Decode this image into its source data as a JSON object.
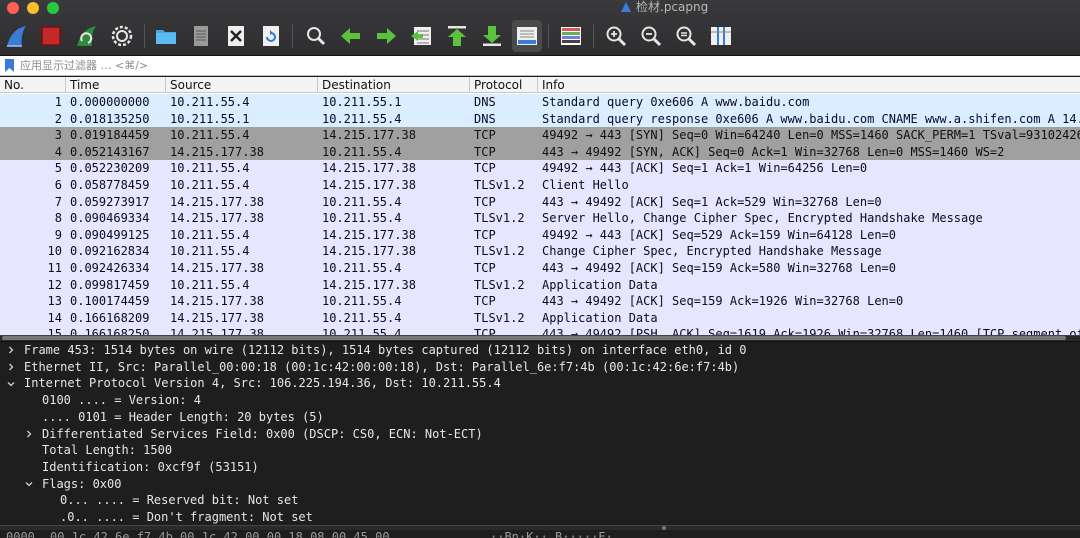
{
  "window": {
    "title": "检材.pcapng"
  },
  "toolbar": {
    "buttons": [
      {
        "name": "start-capture-button",
        "icon": "shark-fin-icon"
      },
      {
        "name": "stop-capture-button",
        "icon": "stop-square-icon"
      },
      {
        "name": "restart-capture-button",
        "icon": "restart-fin-icon"
      },
      {
        "name": "capture-options-button",
        "icon": "gear-icon"
      },
      {
        "name": "open-file-button",
        "icon": "folder-icon"
      },
      {
        "name": "save-file-button",
        "icon": "file-icon"
      },
      {
        "name": "close-file-button",
        "icon": "close-file-icon"
      },
      {
        "name": "reload-file-button",
        "icon": "reload-icon"
      },
      {
        "name": "find-packet-button",
        "icon": "search-icon"
      },
      {
        "name": "go-back-button",
        "icon": "arrow-left-icon"
      },
      {
        "name": "go-forward-button",
        "icon": "arrow-right-icon"
      },
      {
        "name": "go-to-packet-button",
        "icon": "go-to-packet-icon"
      },
      {
        "name": "go-first-packet-button",
        "icon": "arrow-up-bar-icon"
      },
      {
        "name": "go-last-packet-button",
        "icon": "arrow-down-bar-icon"
      },
      {
        "name": "auto-scroll-button",
        "icon": "auto-scroll-icon"
      },
      {
        "name": "colorize-button",
        "icon": "colorize-lines-icon"
      },
      {
        "name": "zoom-in-button",
        "icon": "zoom-in-icon"
      },
      {
        "name": "zoom-out-button",
        "icon": "zoom-out-icon"
      },
      {
        "name": "normal-size-button",
        "icon": "zoom-reset-icon"
      },
      {
        "name": "resize-columns-button",
        "icon": "resize-columns-icon"
      }
    ]
  },
  "filter": {
    "placeholder": "应用显示过滤器 … <⌘/>",
    "value": ""
  },
  "packet_list": {
    "columns": [
      "No.",
      "Time",
      "Source",
      "Destination",
      "Protocol",
      "Info"
    ],
    "rows": [
      {
        "no": "1",
        "time": "0.000000000",
        "src": "10.211.55.4",
        "dst": "10.211.55.1",
        "proto": "DNS",
        "info": "Standard query 0xe606 A www.baidu.com",
        "style": "dns"
      },
      {
        "no": "2",
        "time": "0.018135250",
        "src": "10.211.55.1",
        "dst": "10.211.55.4",
        "proto": "DNS",
        "info": "Standard query response 0xe606 A www.baidu.com CNAME www.a.shifen.com A 14.",
        "style": "dns"
      },
      {
        "no": "3",
        "time": "0.019184459",
        "src": "10.211.55.4",
        "dst": "14.215.177.38",
        "proto": "TCP",
        "info": "49492 → 443 [SYN] Seq=0 Win=64240 Len=0 MSS=1460 SACK_PERM=1 TSval=93102426",
        "style": "sel"
      },
      {
        "no": "4",
        "time": "0.052143167",
        "src": "14.215.177.38",
        "dst": "10.211.55.4",
        "proto": "TCP",
        "info": "443 → 49492 [SYN, ACK] Seq=0 Ack=1 Win=32768 Len=0 MSS=1460 WS=2",
        "style": "sel"
      },
      {
        "no": "5",
        "time": "0.052230209",
        "src": "10.211.55.4",
        "dst": "14.215.177.38",
        "proto": "TCP",
        "info": "49492 → 443 [ACK] Seq=1 Ack=1 Win=64256 Len=0",
        "style": "std"
      },
      {
        "no": "6",
        "time": "0.058778459",
        "src": "10.211.55.4",
        "dst": "14.215.177.38",
        "proto": "TLSv1.2",
        "info": "Client Hello",
        "style": "std"
      },
      {
        "no": "7",
        "time": "0.059273917",
        "src": "14.215.177.38",
        "dst": "10.211.55.4",
        "proto": "TCP",
        "info": "443 → 49492 [ACK] Seq=1 Ack=529 Win=32768 Len=0",
        "style": "std"
      },
      {
        "no": "8",
        "time": "0.090469334",
        "src": "14.215.177.38",
        "dst": "10.211.55.4",
        "proto": "TLSv1.2",
        "info": "Server Hello, Change Cipher Spec, Encrypted Handshake Message",
        "style": "std"
      },
      {
        "no": "9",
        "time": "0.090499125",
        "src": "10.211.55.4",
        "dst": "14.215.177.38",
        "proto": "TCP",
        "info": "49492 → 443 [ACK] Seq=529 Ack=159 Win=64128 Len=0",
        "style": "std"
      },
      {
        "no": "10",
        "time": "0.092162834",
        "src": "10.211.55.4",
        "dst": "14.215.177.38",
        "proto": "TLSv1.2",
        "info": "Change Cipher Spec, Encrypted Handshake Message",
        "style": "std"
      },
      {
        "no": "11",
        "time": "0.092426334",
        "src": "14.215.177.38",
        "dst": "10.211.55.4",
        "proto": "TCP",
        "info": "443 → 49492 [ACK] Seq=159 Ack=580 Win=32768 Len=0",
        "style": "std"
      },
      {
        "no": "12",
        "time": "0.099817459",
        "src": "10.211.55.4",
        "dst": "14.215.177.38",
        "proto": "TLSv1.2",
        "info": "Application Data",
        "style": "std"
      },
      {
        "no": "13",
        "time": "0.100174459",
        "src": "14.215.177.38",
        "dst": "10.211.55.4",
        "proto": "TCP",
        "info": "443 → 49492 [ACK] Seq=159 Ack=1926 Win=32768 Len=0",
        "style": "std"
      },
      {
        "no": "14",
        "time": "0.166168209",
        "src": "14.215.177.38",
        "dst": "10.211.55.4",
        "proto": "TLSv1.2",
        "info": "Application Data",
        "style": "std"
      },
      {
        "no": "15",
        "time": "0.166168250",
        "src": "14.215.177.38",
        "dst": "10.211.55.4",
        "proto": "TCP",
        "info": "443 → 49492 [PSH, ACK] Seq=1619 Ack=1926 Win=32768 Len=1460 [TCP segment of",
        "style": "std"
      }
    ]
  },
  "details": {
    "rows": [
      {
        "indent": 0,
        "arrow": "right",
        "text": "Frame 453: 1514 bytes on wire (12112 bits), 1514 bytes captured (12112 bits) on interface eth0, id 0"
      },
      {
        "indent": 0,
        "arrow": "right",
        "text": "Ethernet II, Src: Parallel_00:00:18 (00:1c:42:00:00:18), Dst: Parallel_6e:f7:4b (00:1c:42:6e:f7:4b)"
      },
      {
        "indent": 0,
        "arrow": "down",
        "text": "Internet Protocol Version 4, Src: 106.225.194.36, Dst: 10.211.55.4"
      },
      {
        "indent": 1,
        "arrow": "none",
        "text": "0100 .... = Version: 4"
      },
      {
        "indent": 1,
        "arrow": "none",
        "text": ".... 0101 = Header Length: 20 bytes (5)"
      },
      {
        "indent": 1,
        "arrow": "right",
        "text": "Differentiated Services Field: 0x00 (DSCP: CS0, ECN: Not-ECT)"
      },
      {
        "indent": 1,
        "arrow": "none",
        "text": "Total Length: 1500"
      },
      {
        "indent": 1,
        "arrow": "none",
        "text": "Identification: 0xcf9f (53151)"
      },
      {
        "indent": 1,
        "arrow": "down",
        "text": "Flags: 0x00"
      },
      {
        "indent": 2,
        "arrow": "none",
        "text": "0... .... = Reserved bit: Not set"
      },
      {
        "indent": 2,
        "arrow": "none",
        "text": ".0.. .... = Don't fragment: Not set"
      }
    ]
  },
  "bytes": {
    "offset": "0000",
    "hex": "00 1c 42 6e f7 4b 00 1c  42 00 00 18 08 00 45 00",
    "ascii": "··Bn·K·· B·····E·"
  },
  "colors": {
    "dns_row": "#daeeff",
    "selected_row": "#a0a0a0",
    "tcp_row": "#e7e6ff",
    "details_bg": "#1e1e1e",
    "toolbar_bg": "#333335",
    "accent_blue": "#3a7bd5"
  }
}
